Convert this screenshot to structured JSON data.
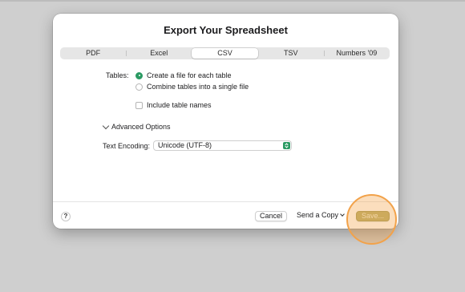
{
  "dialog": {
    "title": "Export Your Spreadsheet",
    "tabs": [
      {
        "label": "PDF"
      },
      {
        "label": "Excel"
      },
      {
        "label": "CSV",
        "active": true
      },
      {
        "label": "TSV"
      },
      {
        "label": "Numbers '09"
      }
    ],
    "tables": {
      "label": "Tables:",
      "options": [
        {
          "label": "Create a file for each table",
          "selected": true
        },
        {
          "label": "Combine tables into a single file",
          "selected": false
        }
      ],
      "include_names": {
        "label": "Include table names",
        "checked": false
      }
    },
    "advanced": {
      "label": "Advanced Options",
      "expanded": true
    },
    "encoding": {
      "label": "Text Encoding:",
      "value": "Unicode (UTF-8)"
    },
    "footer": {
      "help": "?",
      "cancel": "Cancel",
      "send_copy": "Send a Copy",
      "save": "Save..."
    }
  },
  "colors": {
    "accent": "#2b9a63",
    "save_button": "#b9b06a",
    "highlight": "#f2a24a"
  }
}
